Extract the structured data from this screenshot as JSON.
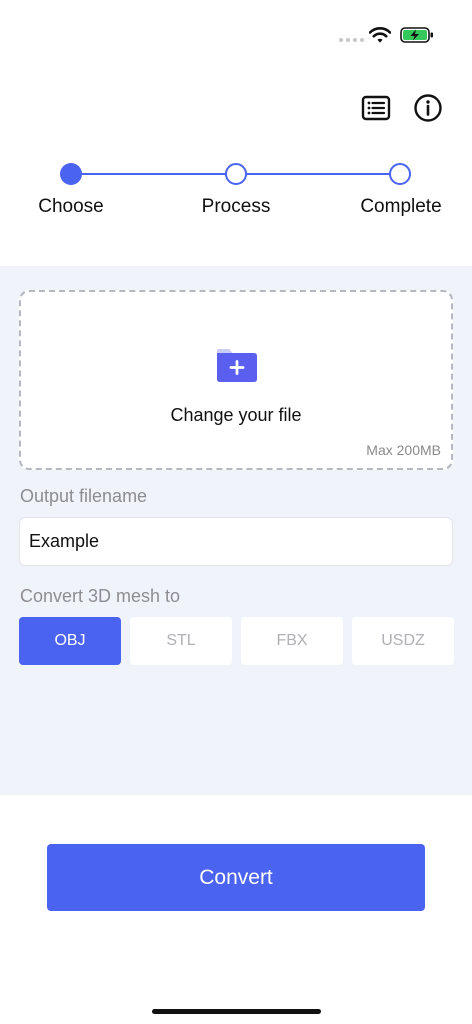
{
  "status_bar": {
    "battery_color": "#34c759"
  },
  "toolbar": {
    "list_icon": "list-icon",
    "info_icon": "info-icon"
  },
  "stepper": {
    "steps": [
      {
        "label": "Choose",
        "state": "active"
      },
      {
        "label": "Process",
        "state": "pending"
      },
      {
        "label": "Complete",
        "state": "pending"
      }
    ]
  },
  "upload": {
    "icon": "folder-plus-icon",
    "title": "Change your file",
    "max_size": "Max 200MB"
  },
  "output": {
    "label": "Output filename",
    "value": "Example"
  },
  "convert_to": {
    "label": "Convert 3D mesh to",
    "options": [
      "OBJ",
      "STL",
      "FBX",
      "USDZ"
    ],
    "selected": "OBJ"
  },
  "actions": {
    "convert_label": "Convert"
  },
  "colors": {
    "accent": "#4a63f0",
    "panel_bg": "#f0f3fa"
  }
}
